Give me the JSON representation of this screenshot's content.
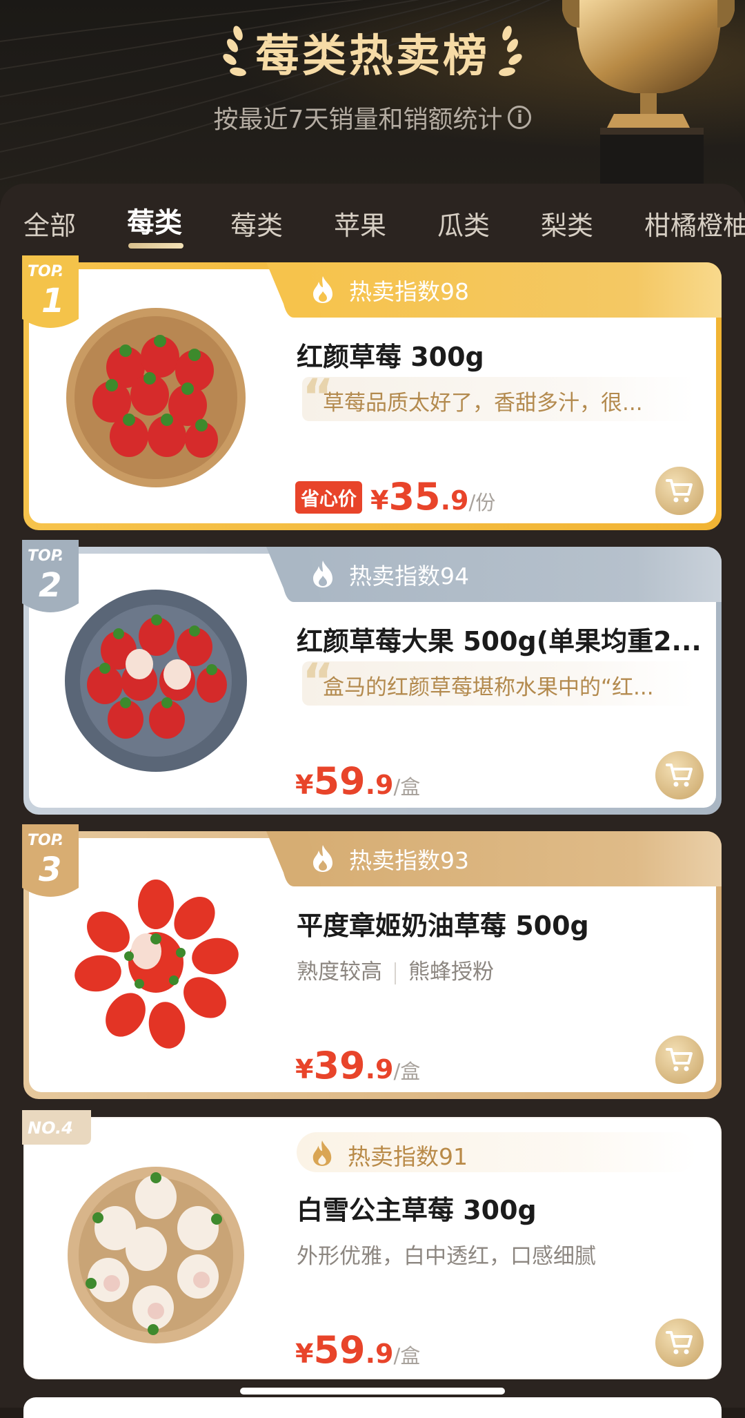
{
  "header": {
    "title": "莓类热卖榜",
    "subtitle": "按最近7天销量和销额统计",
    "info_icon": "info-circle-icon"
  },
  "tabs": [
    {
      "label": "全部",
      "active": false
    },
    {
      "label": "莓类",
      "active": true
    },
    {
      "label": "莓类",
      "active": false
    },
    {
      "label": "苹果",
      "active": false
    },
    {
      "label": "瓜类",
      "active": false
    },
    {
      "label": "梨类",
      "active": false
    },
    {
      "label": "柑橘橙柚",
      "active": false
    }
  ],
  "products": [
    {
      "rank_label": "TOP.",
      "rank": "1",
      "hot_index": "热卖指数98",
      "name": "红颜草莓 300g",
      "quote": "草莓品质太好了，香甜多汁，很...",
      "price_tag": "省心价",
      "yen": "¥",
      "price_int": "35",
      "price_dec": ".9",
      "unit": "/份"
    },
    {
      "rank_label": "TOP.",
      "rank": "2",
      "hot_index": "热卖指数94",
      "name": "红颜草莓大果 500g(单果均重2...",
      "quote": "盒马的红颜草莓堪称水果中的“红...",
      "yen": "¥",
      "price_int": "59",
      "price_dec": ".9",
      "unit": "/盒"
    },
    {
      "rank_label": "TOP.",
      "rank": "3",
      "hot_index": "热卖指数93",
      "name": "平度章姬奶油草莓 500g",
      "tags": [
        "熟度较高",
        "熊蜂授粉"
      ],
      "yen": "¥",
      "price_int": "39",
      "price_dec": ".9",
      "unit": "/盒"
    },
    {
      "rank_label": "NO.4",
      "hot_index": "热卖指数91",
      "name": "白雪公主草莓 300g",
      "tags_text": "外形优雅，白中透红，口感细腻",
      "yen": "¥",
      "price_int": "59",
      "price_dec": ".9",
      "unit": "/盒"
    }
  ],
  "colors": {
    "gold": "#f2b739",
    "silver": "#a9b6c3",
    "bronze": "#d9b27c",
    "price": "#e8442a",
    "title": "#f6dba6"
  }
}
